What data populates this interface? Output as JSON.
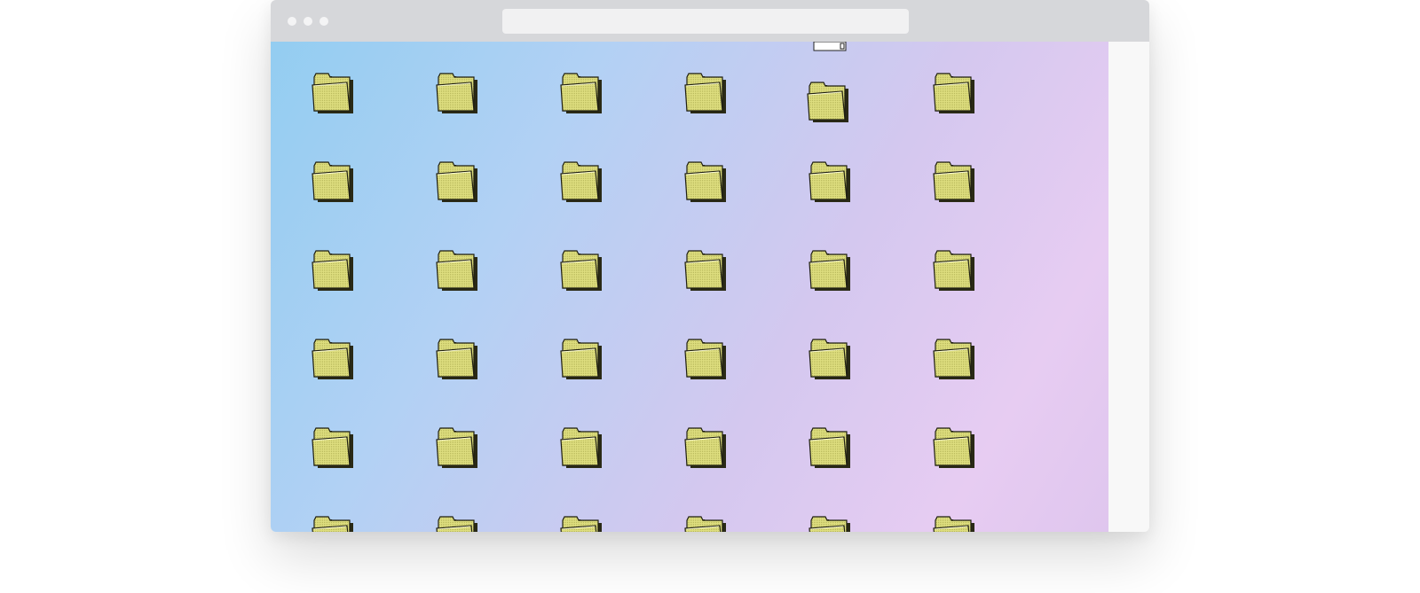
{
  "browser": {
    "address_bar_text": ""
  },
  "colors": {
    "folder_fill": "#dede7f",
    "folder_dots": "#b7b75a",
    "folder_outline": "#1f1f12",
    "folder_shadow": "#2a2a16"
  },
  "desktop": {
    "icon": "folder-icon",
    "columns": 6,
    "rows": [
      {
        "folders": [
          {
            "label": ""
          },
          {
            "label": ""
          },
          {
            "label": ""
          },
          {
            "label": ""
          },
          {
            "label": ""
          },
          {
            "label": ""
          }
        ]
      },
      {
        "folders": [
          {
            "label": ""
          },
          {
            "label": ""
          },
          {
            "label": ""
          },
          {
            "label": ""
          },
          {
            "label": ""
          },
          {
            "label": ""
          }
        ]
      },
      {
        "folders": [
          {
            "label": ""
          },
          {
            "label": ""
          },
          {
            "label": ""
          },
          {
            "label": ""
          },
          {
            "label": ""
          },
          {
            "label": ""
          }
        ]
      },
      {
        "folders": [
          {
            "label": ""
          },
          {
            "label": ""
          },
          {
            "label": ""
          },
          {
            "label": ""
          },
          {
            "label": ""
          },
          {
            "label": ""
          }
        ]
      },
      {
        "folders": [
          {
            "label": ""
          },
          {
            "label": ""
          },
          {
            "label": ""
          },
          {
            "label": ""
          },
          {
            "label": ""
          },
          {
            "label": ""
          }
        ]
      },
      {
        "folders": [
          {
            "label": ""
          },
          {
            "label": ""
          },
          {
            "label": ""
          },
          {
            "label": ""
          },
          {
            "label": ""
          },
          {
            "label": ""
          }
        ]
      }
    ]
  }
}
